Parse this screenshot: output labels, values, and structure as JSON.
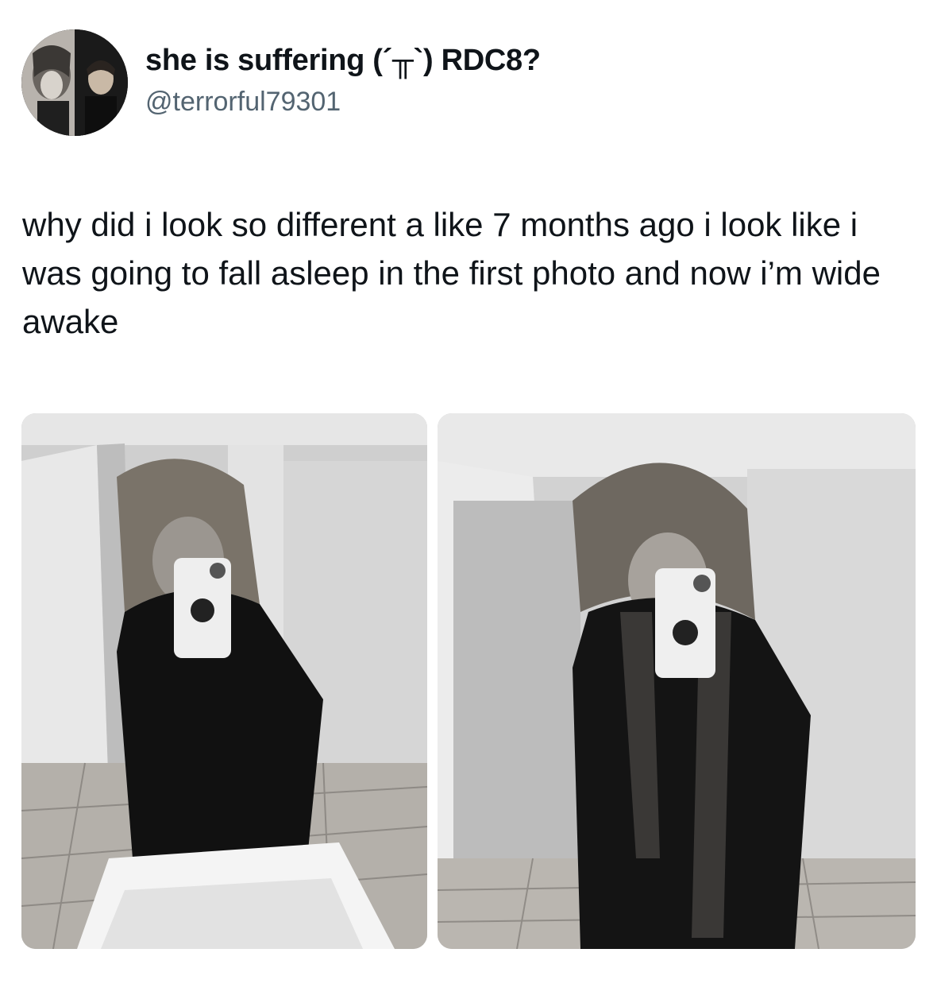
{
  "tweet": {
    "display_name": "she is suffering (´╥`) RDC8?",
    "handle": "@terrorful79301",
    "text": "why did i look so different a like 7 months ago i look like i was going to fall asleep in the first photo and now i’m wide awake",
    "avatar_icon": "avatar-image",
    "media": [
      {
        "name": "mirror-selfie-before",
        "icon": "photo-image"
      },
      {
        "name": "mirror-selfie-after",
        "icon": "photo-image"
      }
    ]
  },
  "colors": {
    "text": "#0f1419",
    "secondary_text": "#536471",
    "background": "#ffffff"
  }
}
